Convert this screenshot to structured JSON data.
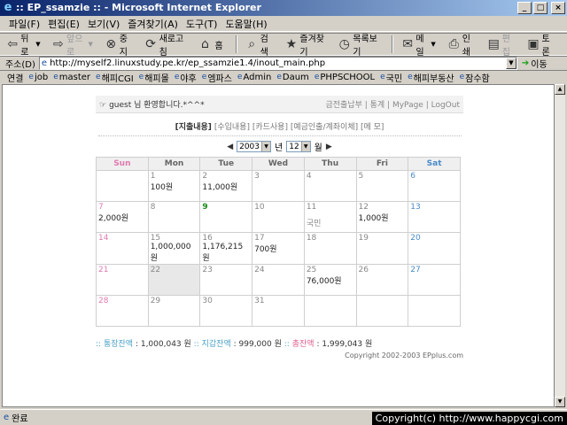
{
  "window": {
    "title": ":: EP_ssamzie :: - Microsoft Internet Explorer",
    "min": "_",
    "max": "□",
    "close": "×"
  },
  "menu": [
    "파일(F)",
    "편집(E)",
    "보기(V)",
    "즐겨찾기(A)",
    "도구(T)",
    "도움말(H)"
  ],
  "toolbar": {
    "back": "뒤로",
    "forward": "앞으로",
    "stop": "중지",
    "refresh": "새로고침",
    "home": "홈",
    "search": "검색",
    "favorites": "즐겨찾기",
    "history": "목록보기",
    "mail": "메일",
    "print": "인쇄",
    "edit": "편집",
    "discuss": "토론"
  },
  "address": {
    "label": "주소(D)",
    "url": "http://myself2.linuxstudy.pe.kr/ep_ssamzie1.4/inout_main.php",
    "go": "이동"
  },
  "links": {
    "label": "연결",
    "items": [
      "job",
      "master",
      "해피CGI",
      "해피몰",
      "야후",
      "엠파스",
      "Admin",
      "Daum",
      "PHPSCHOOL",
      "국민",
      "해피부동산",
      "잠수함"
    ]
  },
  "page": {
    "greeting": "guest 님 환영합니다.*^^*",
    "toplinks": "금전출납부 | 통계 | MyPage | LogOut",
    "submenu": {
      "active": "[지출내용]",
      "rest": "[수입내용] [카드사용] [예금인출/계좌이체] [메 모]"
    },
    "year": "2003",
    "year_unit": "년",
    "month": "12",
    "month_unit": "월",
    "weekdays": [
      "Sun",
      "Mon",
      "Tue",
      "Wed",
      "Thu",
      "Fri",
      "Sat"
    ],
    "weeks": [
      [
        {
          "d": ""
        },
        {
          "d": "1",
          "a": "100원"
        },
        {
          "d": "2",
          "a": "11,000원"
        },
        {
          "d": "3"
        },
        {
          "d": "4"
        },
        {
          "d": "5"
        },
        {
          "d": "6"
        }
      ],
      [
        {
          "d": "7",
          "a": "2,000원"
        },
        {
          "d": "8"
        },
        {
          "d": "9",
          "today": true
        },
        {
          "d": "10"
        },
        {
          "d": "11",
          "n": "국민"
        },
        {
          "d": "12",
          "a": "1,000원"
        },
        {
          "d": "13"
        }
      ],
      [
        {
          "d": "14"
        },
        {
          "d": "15",
          "a": "1,000,000원"
        },
        {
          "d": "16",
          "a": "1,176,215원"
        },
        {
          "d": "17",
          "a": "700원"
        },
        {
          "d": "18"
        },
        {
          "d": "19"
        },
        {
          "d": "20"
        }
      ],
      [
        {
          "d": "21"
        },
        {
          "d": "22",
          "hl": true
        },
        {
          "d": "23"
        },
        {
          "d": "24"
        },
        {
          "d": "25",
          "a": "76,000원"
        },
        {
          "d": "26"
        },
        {
          "d": "27"
        }
      ],
      [
        {
          "d": "28"
        },
        {
          "d": "29"
        },
        {
          "d": "30"
        },
        {
          "d": "31"
        },
        {
          "d": ""
        },
        {
          "d": ""
        },
        {
          "d": ""
        }
      ]
    ],
    "summary": {
      "bank_label": "통장잔액",
      "bank_value": ": 1,000,043 원",
      "cash_label": "지갑잔액",
      "cash_value": ": 999,000 원",
      "total_label": "총잔액",
      "total_value": ": 1,999,043 원"
    },
    "copyright": "Copyright 2002-2003 EPplus.com"
  },
  "status": {
    "text": "완료",
    "overlay": "Copyright(c) http://www.happycgi.com"
  }
}
